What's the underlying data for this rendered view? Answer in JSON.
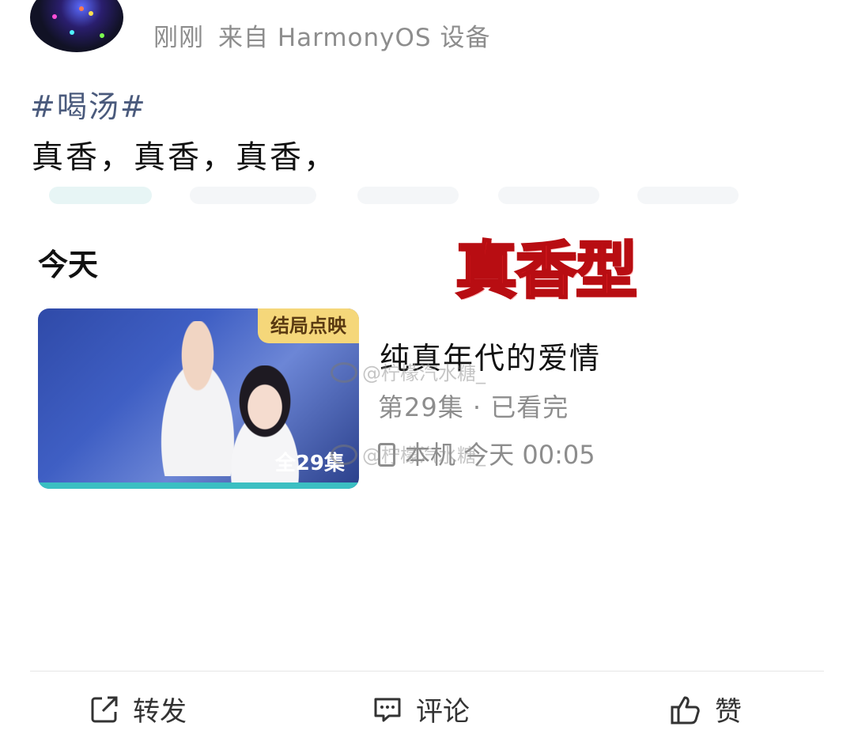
{
  "post": {
    "time": "刚刚",
    "source": "来自 HarmonyOS 设备",
    "hashtag": "#喝汤#",
    "text": "真香，真香，真香，"
  },
  "overlay_caption": "真香型",
  "watch_history": {
    "section_title": "今天",
    "item": {
      "badge": "结局点映",
      "episode_count": "全29集",
      "title": "纯真年代的爱情",
      "episode_status": "第29集 · 已看完",
      "device": "本机",
      "time": "今天 00:05"
    }
  },
  "watermarks": [
    "@柠檬汽水糖_",
    "@柠檬汽水糖_"
  ],
  "actions": {
    "repost": "转发",
    "comment": "评论",
    "like": "赞"
  },
  "colors": {
    "hashtag": "#4a5a7c",
    "caption_red": "#e8232a",
    "badge_gold": "#f5d77a",
    "meta_gray": "#8d8d8d"
  },
  "icons": {
    "repost": "share-out-icon",
    "comment": "chat-bubble-icon",
    "like": "thumbs-up-icon",
    "device": "phone-icon"
  }
}
